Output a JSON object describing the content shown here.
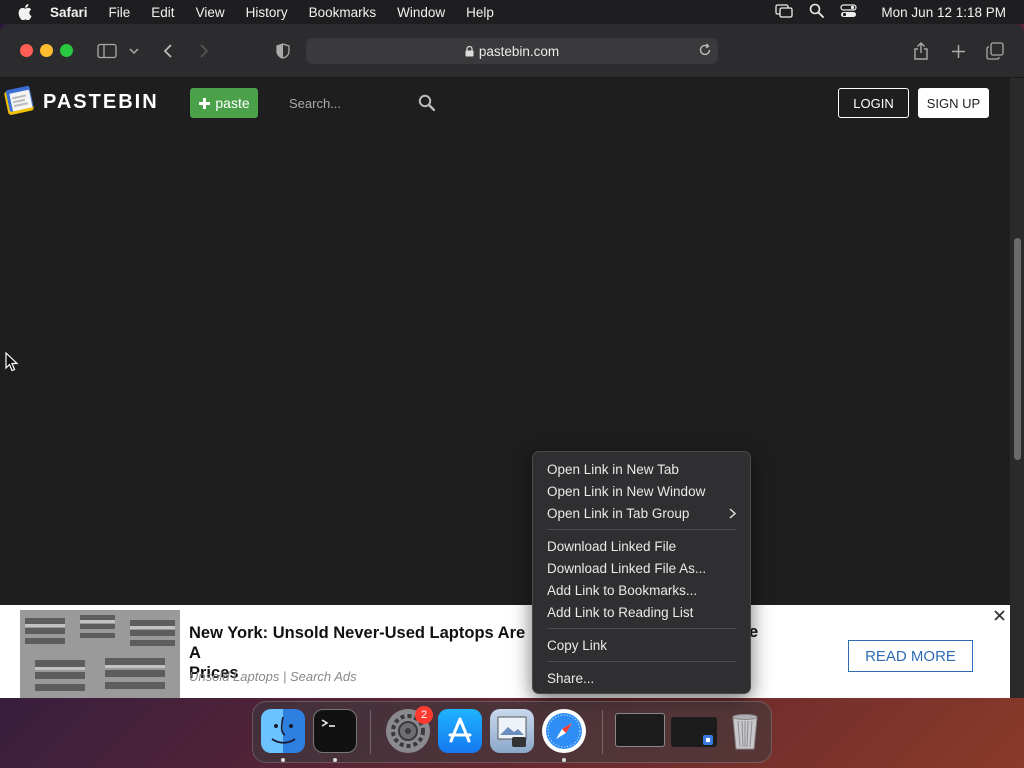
{
  "menubar": {
    "app_name": "Safari",
    "items": [
      "File",
      "Edit",
      "View",
      "History",
      "Bookmarks",
      "Window",
      "Help"
    ],
    "clock": "Mon Jun 12  1:18 PM"
  },
  "browser": {
    "url": "pastebin.com"
  },
  "site": {
    "brand": "PASTEBIN",
    "paste_label": "paste",
    "search_placeholder": "Search...",
    "login_label": "LOGIN",
    "signup_label": "SIGN UP"
  },
  "ad": {
    "title": "New York: Unsold Never-Used Laptops Are A",
    "title_line2": "Prices",
    "title_tail": "e",
    "source": "Unsold Laptops | Search Ads",
    "cta": "READ MORE"
  },
  "context_menu": {
    "group1": [
      "Open Link in New Tab",
      "Open Link in New Window",
      "Open Link in Tab Group"
    ],
    "group2": [
      "Download Linked File",
      "Download Linked File As...",
      "Add Link to Bookmarks...",
      "Add Link to Reading List"
    ],
    "group3": [
      "Copy Link"
    ],
    "group4": [
      "Share..."
    ]
  },
  "dock": {
    "settings_badge": "2",
    "apps": [
      "Finder",
      "Terminal",
      "System Settings",
      "App Store",
      "Preview",
      "Safari",
      "Screenshot window",
      "Window thumbnail",
      "Trash"
    ]
  }
}
